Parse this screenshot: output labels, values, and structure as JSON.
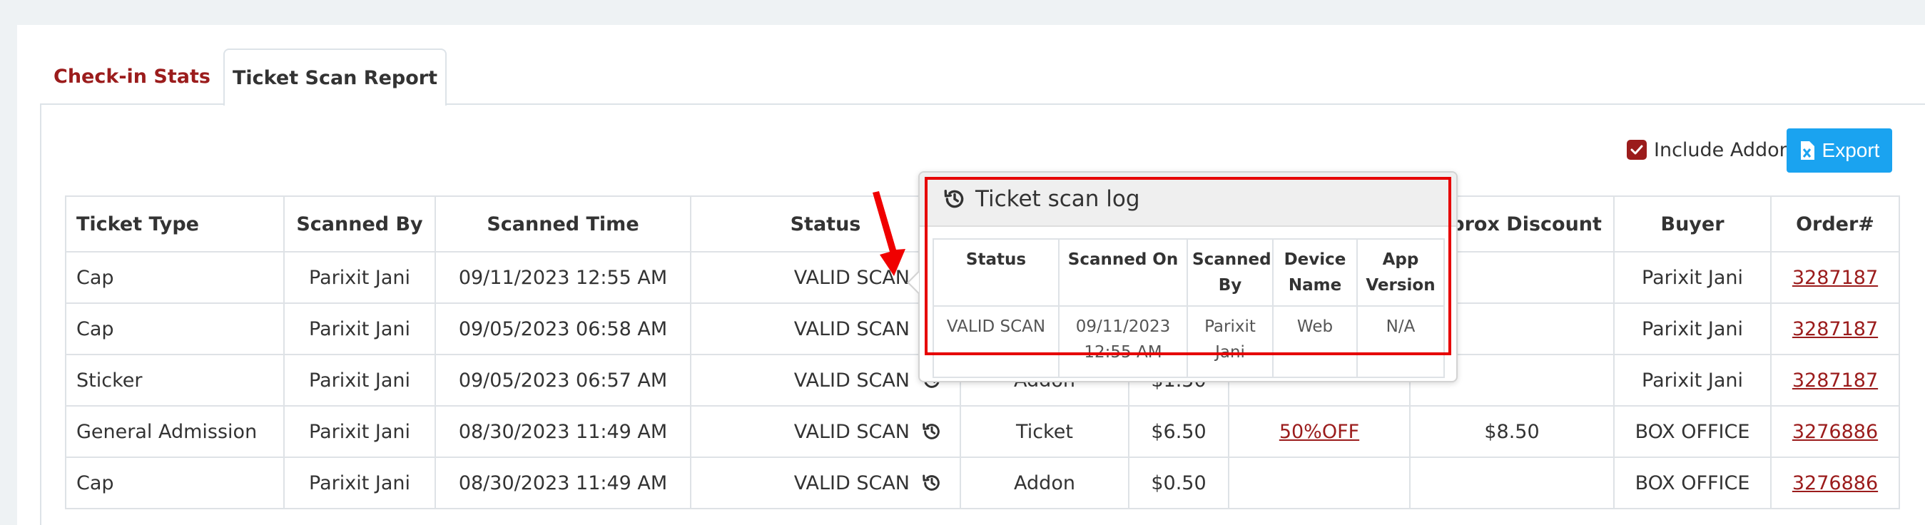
{
  "tabs": [
    {
      "label": "Check-in Stats"
    },
    {
      "label": "Ticket Scan Report"
    }
  ],
  "toolbar": {
    "include_addon_label": "Include Addon",
    "include_addon_checked": true,
    "export_label": "Export"
  },
  "table": {
    "headers": [
      "Ticket Type",
      "Scanned By",
      "Scanned Time",
      "Status",
      "",
      "",
      "",
      "Approx Discount",
      "Buyer",
      "Order#"
    ],
    "rows": [
      {
        "ticket_type": "Cap",
        "scanned_by": "Parixit Jani",
        "scanned_time": "09/11/2023 12:55 AM",
        "status": "VALID SCAN",
        "type": "",
        "price": "",
        "discount_code": "",
        "approx_discount": "",
        "buyer": "Parixit Jani",
        "order": "3287187"
      },
      {
        "ticket_type": "Cap",
        "scanned_by": "Parixit Jani",
        "scanned_time": "09/05/2023 06:58 AM",
        "status": "VALID SCAN",
        "type": "",
        "price": "",
        "discount_code": "",
        "approx_discount": "",
        "buyer": "Parixit Jani",
        "order": "3287187"
      },
      {
        "ticket_type": "Sticker",
        "scanned_by": "Parixit Jani",
        "scanned_time": "09/05/2023 06:57 AM",
        "status": "VALID SCAN",
        "type": "Addon",
        "price": "$1.50",
        "discount_code": "",
        "approx_discount": "",
        "buyer": "Parixit Jani",
        "order": "3287187"
      },
      {
        "ticket_type": "General Admission",
        "scanned_by": "Parixit Jani",
        "scanned_time": "08/30/2023 11:49 AM",
        "status": "VALID SCAN",
        "type": "Ticket",
        "price": "$6.50",
        "discount_code": "50%OFF",
        "approx_discount": "$8.50",
        "buyer": "BOX OFFICE",
        "order": "3276886"
      },
      {
        "ticket_type": "Cap",
        "scanned_by": "Parixit Jani",
        "scanned_time": "08/30/2023 11:49 AM",
        "status": "VALID SCAN",
        "type": "Addon",
        "price": "$0.50",
        "discount_code": "",
        "approx_discount": "",
        "buyer": "BOX OFFICE",
        "order": "3276886"
      }
    ]
  },
  "popover": {
    "title": "Ticket scan log",
    "headers": [
      "Status",
      "Scanned On",
      "Scanned By",
      "Device Name",
      "App Version"
    ],
    "row": {
      "status": "VALID SCAN",
      "scanned_on": "09/11/2023 12:55 AM",
      "scanned_by": "Parixit Jani",
      "device_name": "Web",
      "app_version": "N/A"
    }
  },
  "colors": {
    "accent": "#9b1c1c",
    "export_button": "#1aa3f0",
    "highlight": "#e60000"
  }
}
